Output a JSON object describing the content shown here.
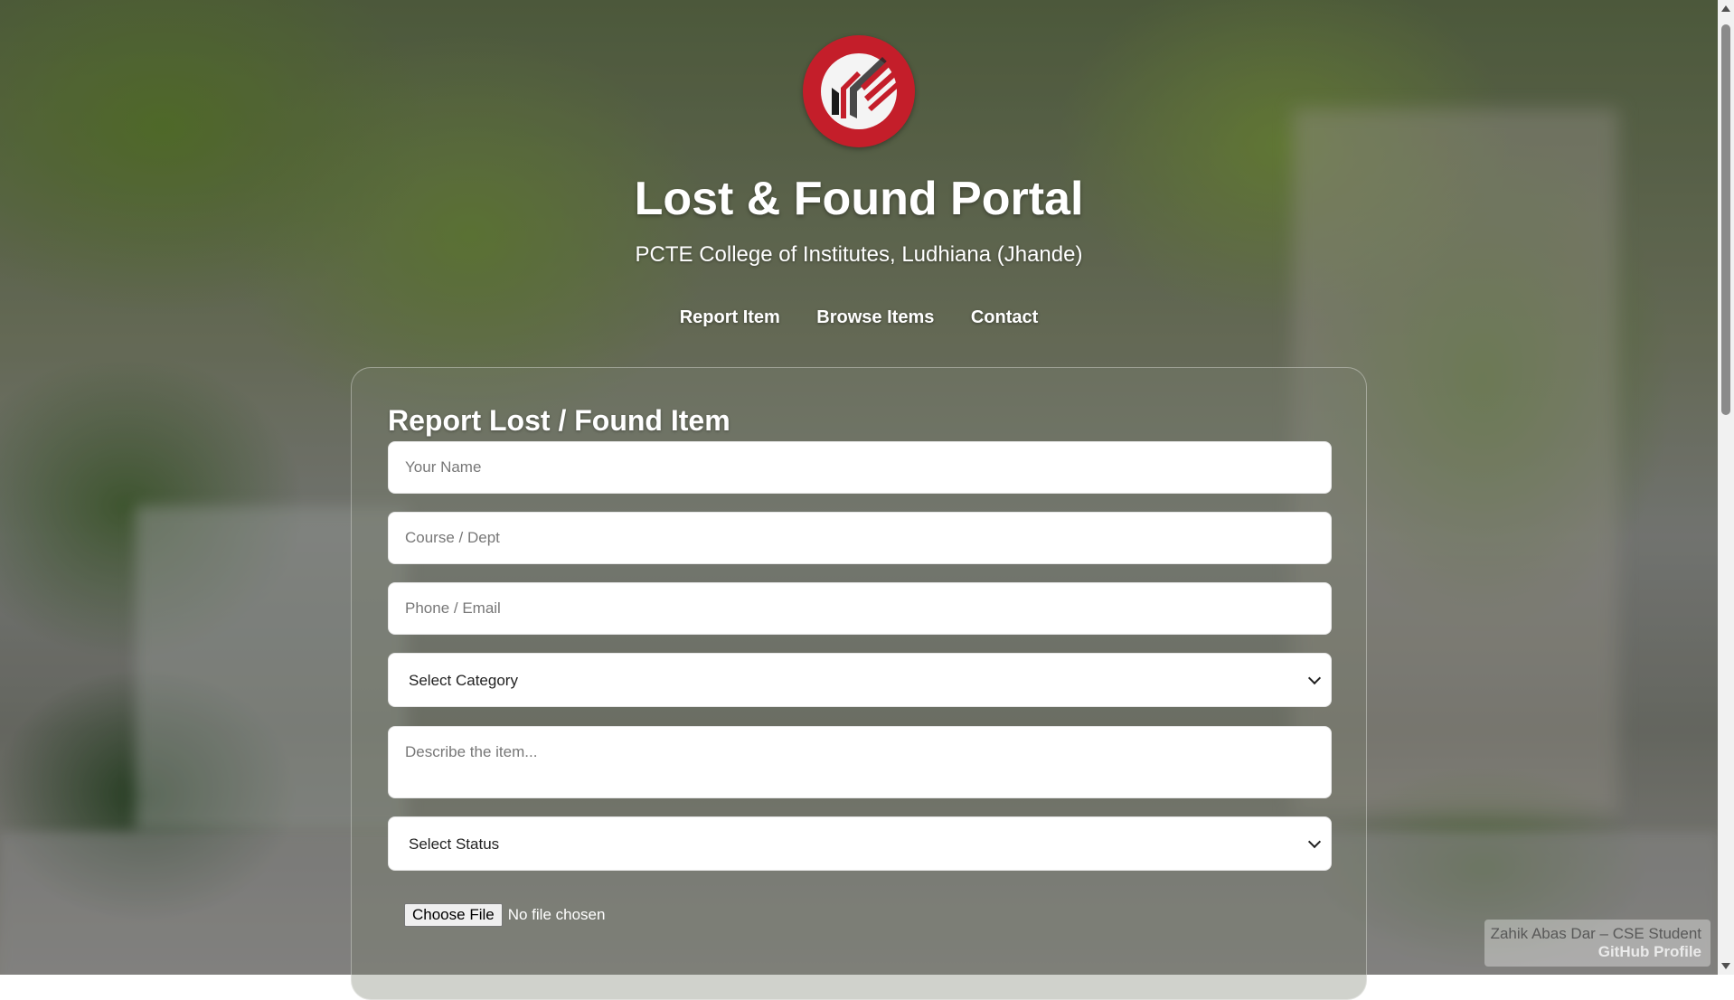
{
  "header": {
    "title": "Lost & Found Portal",
    "subtitle": "PCTE College of Institutes, Ludhiana (Jhande)"
  },
  "nav": {
    "items": [
      {
        "label": "Report Item"
      },
      {
        "label": "Browse Items"
      },
      {
        "label": "Contact"
      }
    ]
  },
  "form": {
    "heading": "Report Lost / Found Item",
    "name_placeholder": "Your Name",
    "course_placeholder": "Course / Dept",
    "contact_placeholder": "Phone / Email",
    "category_selected": "Select Category",
    "description_placeholder": "Describe the item...",
    "status_selected": "Select Status",
    "file_button": "Choose File",
    "file_status": "No file chosen"
  },
  "footer": {
    "author": "Zahik Abas Dar – CSE Student",
    "profile_link": "GitHub Profile"
  },
  "colors": {
    "logo_red": "#c41e2a"
  }
}
